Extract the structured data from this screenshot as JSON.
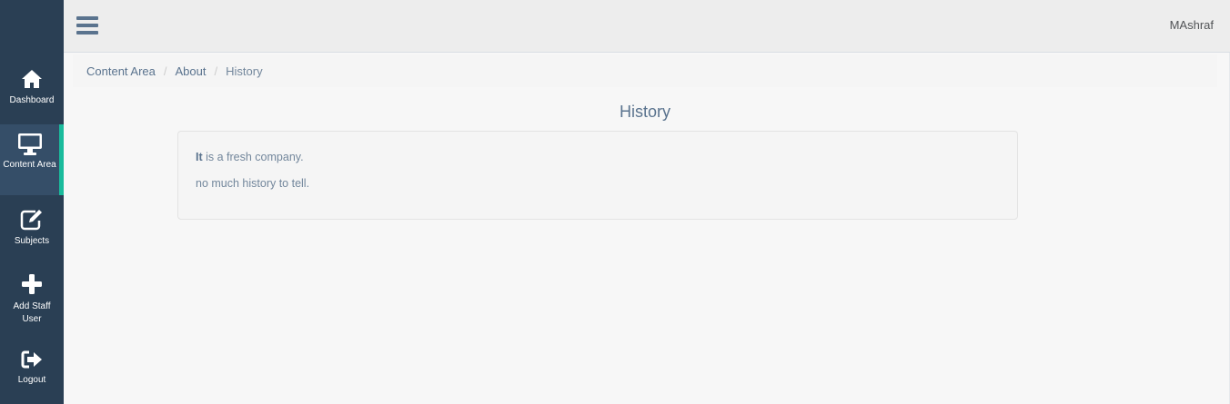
{
  "sidebar": {
    "items": [
      {
        "label": "Dashboard",
        "icon": "home-icon",
        "active": false
      },
      {
        "label": "Content Area",
        "icon": "desktop-icon",
        "active": true
      },
      {
        "label": "Subjects",
        "icon": "edit-icon",
        "active": false
      },
      {
        "label": "Add Staff User",
        "icon": "plus-icon",
        "active": false
      },
      {
        "label": "Logout",
        "icon": "sign-out-icon",
        "active": false
      }
    ]
  },
  "topbar": {
    "menu_icon": "hamburger-icon",
    "user": "MAshraf"
  },
  "breadcrumb": [
    "Content Area",
    "About",
    "History"
  ],
  "page": {
    "title": "History",
    "lead_bold": "It",
    "lead_rest": " is a fresh company.",
    "line2": "no much history to tell."
  },
  "colors": {
    "sidebar": "#2a3f54",
    "accent": "#1abb9c",
    "text": "#73879c",
    "heading": "#5a738e"
  }
}
